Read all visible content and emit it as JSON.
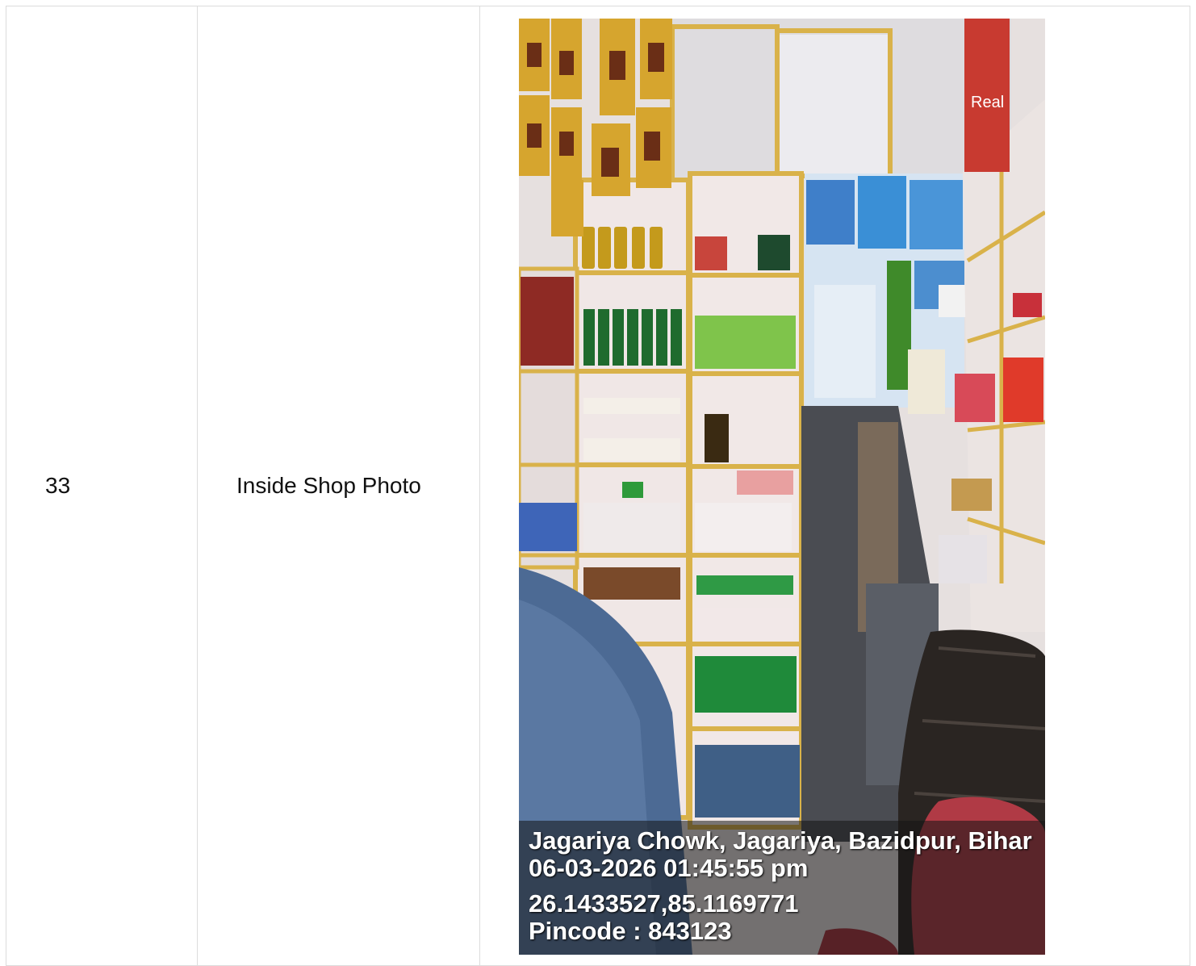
{
  "row": {
    "serial": "33",
    "label": "Inside Shop Photo"
  },
  "photo": {
    "description_icon": "shop-interior-photo",
    "geotag": {
      "address": "Jagariya Chowk, Jagariya, Bazidpur, Bihar",
      "datetime": "06-03-2026 01:45:55 pm",
      "coordinates": "26.1433527,85.1169771",
      "pincode": "Pincode : 843123"
    },
    "product_packet_text": "Real"
  },
  "colors": {
    "border": "#dcdcdc",
    "shelf_wood": "#d9b24a",
    "wall": "#ece6e6"
  }
}
